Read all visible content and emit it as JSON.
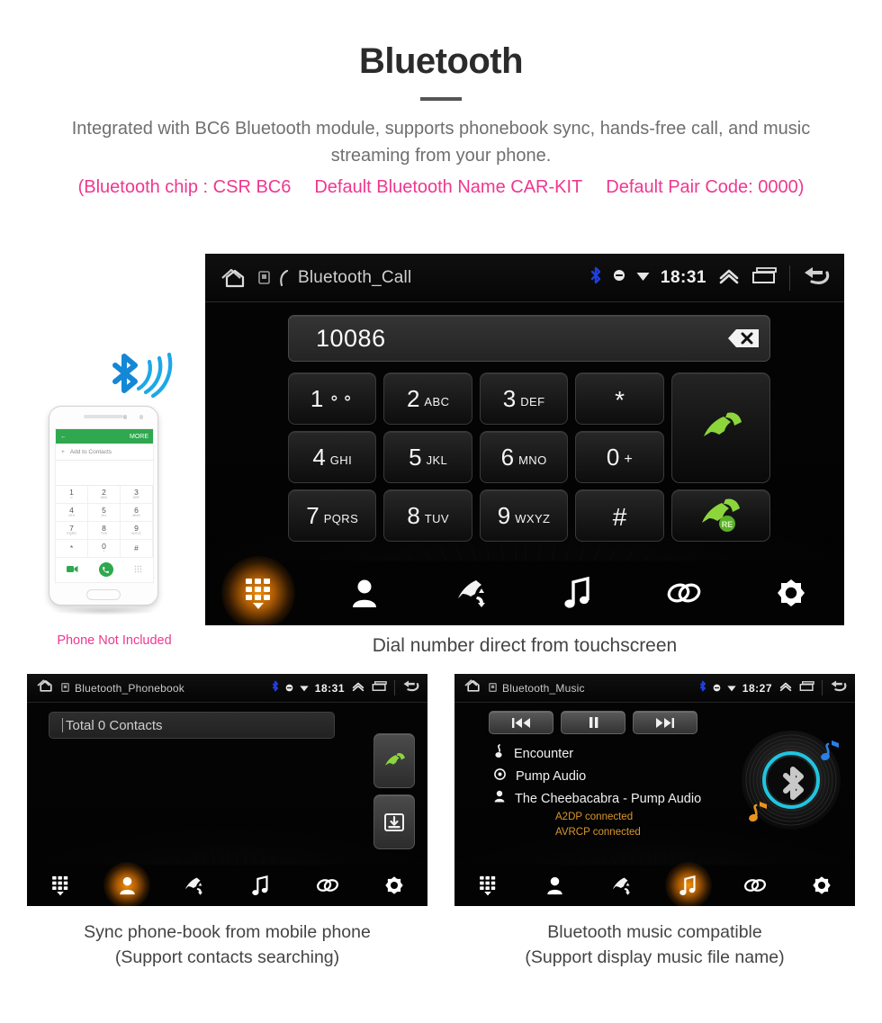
{
  "header": {
    "title": "Bluetooth",
    "subtitle": "Integrated with BC6 Bluetooth module, supports phonebook sync, hands-free call, and music streaming from your phone.",
    "spec_chip": "(Bluetooth chip : CSR BC6",
    "spec_name": "Default Bluetooth Name CAR-KIT",
    "spec_pair": "Default Pair Code: 0000)",
    "pink_color": "#f0378f",
    "title_color": "#2b2b2b"
  },
  "phone_illustration": {
    "note": "Phone Not Included",
    "screen": {
      "more_label": "MORE",
      "add_contacts": "Add to Contacts",
      "keys": [
        {
          "num": "1",
          "sub": "∞"
        },
        {
          "num": "2",
          "sub": "ABC"
        },
        {
          "num": "3",
          "sub": "DEF"
        },
        {
          "num": "4",
          "sub": "GHI"
        },
        {
          "num": "5",
          "sub": "JKL"
        },
        {
          "num": "6",
          "sub": "MNO"
        },
        {
          "num": "7",
          "sub": "PQRS"
        },
        {
          "num": "8",
          "sub": "TUV"
        },
        {
          "num": "9",
          "sub": "WXYZ"
        },
        {
          "num": "*",
          "sub": ""
        },
        {
          "num": "0",
          "sub": "+"
        },
        {
          "num": "#",
          "sub": ""
        }
      ]
    }
  },
  "main_screen": {
    "statusbar": {
      "title": "Bluetooth_Call",
      "time": "18:31",
      "icons": [
        "home-icon",
        "sim-icon",
        "call-icon",
        "bluetooth-icon",
        "mute-icon",
        "wifi-icon",
        "collapse-icon",
        "recents-icon",
        "back-icon"
      ],
      "bluetooth_color": "#1f3fe0"
    },
    "dial": {
      "number": "10086",
      "backspace_label": "backspace-icon"
    },
    "keypad": [
      {
        "num": "1",
        "sub": "◦ₐ"
      },
      {
        "num": "2",
        "sub": "ABC"
      },
      {
        "num": "3",
        "sub": "DEF"
      },
      {
        "num": "*",
        "sub": ""
      },
      {
        "num": "4",
        "sub": "GHI"
      },
      {
        "num": "5",
        "sub": "JKL"
      },
      {
        "num": "6",
        "sub": "MNO"
      },
      {
        "num": "0",
        "sub": "+"
      },
      {
        "num": "7",
        "sub": "PQRS"
      },
      {
        "num": "8",
        "sub": "TUV"
      },
      {
        "num": "9",
        "sub": "WXYZ"
      },
      {
        "num": "#",
        "sub": ""
      }
    ],
    "answer_button": "call-answer-icon",
    "redial_button": "call-redial-icon",
    "redial_badge": "RE",
    "nav": [
      "keypad-icon",
      "contacts-icon",
      "call-history-icon",
      "music-icon",
      "link-icon",
      "settings-icon"
    ],
    "nav_active_index": 0,
    "nav_active_color": "#ff960a",
    "caption": "Dial number direct from touchscreen"
  },
  "phonebook_screen": {
    "statusbar": {
      "title": "Bluetooth_Phonebook",
      "time": "18:31"
    },
    "search_text": "Total 0 Contacts",
    "side_buttons": [
      "call-answer-icon",
      "download-contacts-icon"
    ],
    "nav": [
      "keypad-icon",
      "contacts-icon",
      "call-history-icon",
      "music-icon",
      "link-icon",
      "settings-icon"
    ],
    "nav_active_index": 1,
    "caption_line1": "Sync phone-book from mobile phone",
    "caption_line2": "(Support contacts searching)"
  },
  "music_screen": {
    "statusbar": {
      "title": "Bluetooth_Music",
      "time": "18:27"
    },
    "controls": [
      "previous-track-icon",
      "pause-icon",
      "next-track-icon"
    ],
    "track": {
      "title": "Encounter",
      "album": "Pump Audio",
      "artist": "The Cheebacabra - Pump Audio"
    },
    "status_lines": [
      "A2DP connected",
      "AVRCP connected"
    ],
    "status_color": "#d8972c",
    "nav": [
      "keypad-icon",
      "contacts-icon",
      "call-history-icon",
      "music-icon",
      "link-icon",
      "settings-icon"
    ],
    "nav_active_index": 3,
    "caption_line1": "Bluetooth music compatible",
    "caption_line2": "(Support display music file name)"
  }
}
